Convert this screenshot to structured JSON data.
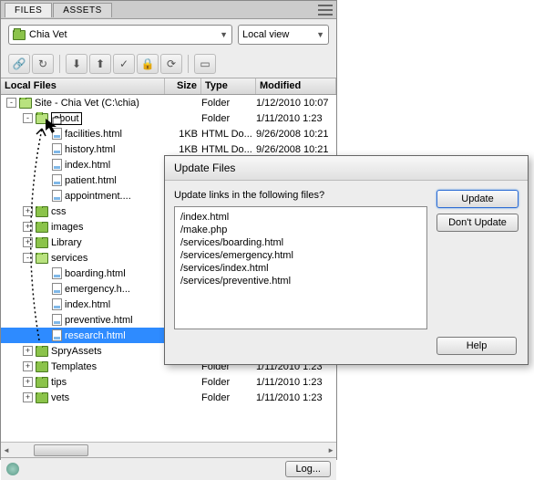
{
  "tabs": {
    "files": "FILES",
    "assets": "ASSETS"
  },
  "site_select": "Chia Vet",
  "view_select": "Local view",
  "columns": {
    "name": "Local Files",
    "size": "Size",
    "type": "Type",
    "modified": "Modified"
  },
  "tree": [
    {
      "indent": 0,
      "exp": "-",
      "icon": "folder-open",
      "label": "Site - Chia Vet (C:\\chia)",
      "size": "",
      "type": "Folder",
      "mod": "1/12/2010 10:07"
    },
    {
      "indent": 1,
      "exp": "-",
      "icon": "folder-open",
      "label": "about",
      "size": "",
      "type": "Folder",
      "mod": "1/11/2010 1:23",
      "boxed": true
    },
    {
      "indent": 2,
      "exp": "",
      "icon": "file",
      "label": "facilities.html",
      "size": "1KB",
      "type": "HTML Do...",
      "mod": "9/26/2008 10:21"
    },
    {
      "indent": 2,
      "exp": "",
      "icon": "file",
      "label": "history.html",
      "size": "1KB",
      "type": "HTML Do...",
      "mod": "9/26/2008 10:21"
    },
    {
      "indent": 2,
      "exp": "",
      "icon": "file",
      "label": "index.html",
      "size": "",
      "type": "",
      "mod": ""
    },
    {
      "indent": 2,
      "exp": "",
      "icon": "file",
      "label": "patient.html",
      "size": "",
      "type": "",
      "mod": ""
    },
    {
      "indent": 2,
      "exp": "",
      "icon": "file",
      "label": "appointment....",
      "size": "",
      "type": "",
      "mod": ""
    },
    {
      "indent": 1,
      "exp": "+",
      "icon": "folder",
      "label": "css",
      "size": "",
      "type": "",
      "mod": ""
    },
    {
      "indent": 1,
      "exp": "+",
      "icon": "folder",
      "label": "images",
      "size": "",
      "type": "",
      "mod": ""
    },
    {
      "indent": 1,
      "exp": "+",
      "icon": "folder",
      "label": "Library",
      "size": "",
      "type": "",
      "mod": ""
    },
    {
      "indent": 1,
      "exp": "-",
      "icon": "folder-open",
      "label": "services",
      "size": "",
      "type": "",
      "mod": ""
    },
    {
      "indent": 2,
      "exp": "",
      "icon": "file",
      "label": "boarding.html",
      "size": "",
      "type": "",
      "mod": ""
    },
    {
      "indent": 2,
      "exp": "",
      "icon": "file",
      "label": "emergency.h...",
      "size": "",
      "type": "",
      "mod": ""
    },
    {
      "indent": 2,
      "exp": "",
      "icon": "file",
      "label": "index.html",
      "size": "",
      "type": "",
      "mod": ""
    },
    {
      "indent": 2,
      "exp": "",
      "icon": "file",
      "label": "preventive.html",
      "size": "",
      "type": "",
      "mod": ""
    },
    {
      "indent": 2,
      "exp": "",
      "icon": "file",
      "label": "research.html",
      "size": "",
      "type": "",
      "mod": "",
      "selected": true
    },
    {
      "indent": 1,
      "exp": "+",
      "icon": "folder",
      "label": "SpryAssets",
      "size": "",
      "type": "",
      "mod": ""
    },
    {
      "indent": 1,
      "exp": "+",
      "icon": "folder",
      "label": "Templates",
      "size": "",
      "type": "Folder",
      "mod": "1/11/2010 1:23"
    },
    {
      "indent": 1,
      "exp": "+",
      "icon": "folder",
      "label": "tips",
      "size": "",
      "type": "Folder",
      "mod": "1/11/2010 1:23"
    },
    {
      "indent": 1,
      "exp": "+",
      "icon": "folder",
      "label": "vets",
      "size": "",
      "type": "Folder",
      "mod": "1/11/2010 1:23"
    }
  ],
  "log_button": "Log...",
  "dialog": {
    "title": "Update Files",
    "question": "Update links in the following files?",
    "files": [
      "/index.html",
      "/make.php",
      "/services/boarding.html",
      "/services/emergency.html",
      "/services/index.html",
      "/services/preventive.html"
    ],
    "update": "Update",
    "dont_update": "Don't Update",
    "help": "Help"
  }
}
